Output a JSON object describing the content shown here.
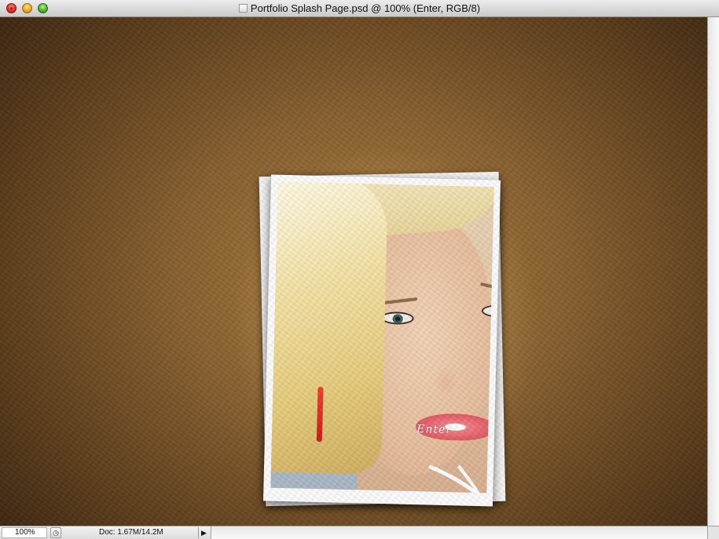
{
  "window": {
    "title": "Portfolio Splash Page.psd @ 100% (Enter, RGB/8)"
  },
  "canvas": {
    "enter_label": "Enter",
    "colors": {
      "background_center": "#a77a3f",
      "background_edge": "#3a2510",
      "frame": "#fbfbfb"
    }
  },
  "statusbar": {
    "zoom": "100%",
    "doc_info": "Doc: 1.67M/14.2M",
    "menu_arrow": "▶",
    "status_icon": "◷"
  }
}
